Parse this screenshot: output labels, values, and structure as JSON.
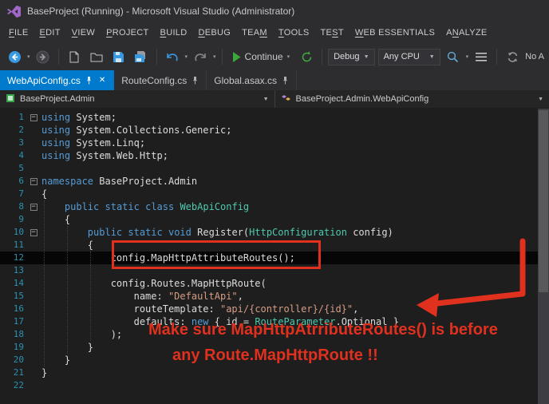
{
  "window": {
    "title": "BaseProject (Running) - Microsoft Visual Studio (Administrator)"
  },
  "menu": {
    "items": [
      {
        "label": "FILE",
        "underline": 0
      },
      {
        "label": "EDIT",
        "underline": 0
      },
      {
        "label": "VIEW",
        "underline": 0
      },
      {
        "label": "PROJECT",
        "underline": 0
      },
      {
        "label": "BUILD",
        "underline": 0
      },
      {
        "label": "DEBUG",
        "underline": 0
      },
      {
        "label": "TEAM",
        "underline": 3
      },
      {
        "label": "TOOLS",
        "underline": 0
      },
      {
        "label": "TEST",
        "underline": 2
      },
      {
        "label": "WEB ESSENTIALS",
        "underline": 0
      },
      {
        "label": "ANALYZE",
        "underline": 1
      }
    ]
  },
  "toolbar": {
    "continue_label": "Continue",
    "debug_value": "Debug",
    "platform_value": "Any CPU",
    "right_label": "No A"
  },
  "tabs": [
    {
      "label": "WebApiConfig.cs",
      "active": true,
      "pinned": true,
      "closable": true
    },
    {
      "label": "RouteConfig.cs",
      "active": false,
      "pinned": true,
      "closable": false
    },
    {
      "label": "Global.asax.cs",
      "active": false,
      "pinned": true,
      "closable": false
    }
  ],
  "breadcrumb": {
    "left": "BaseProject.Admin",
    "right": "BaseProject.Admin.WebApiConfig"
  },
  "icons": {
    "close": "✕",
    "caret_down": "▾",
    "combo_caret": "▼",
    "fold_minus": "−"
  },
  "colors": {
    "accent": "#007ACC",
    "annotation_red": "#E0301E",
    "keyword": "#569CD6",
    "type": "#4EC9B0",
    "string": "#D69D85",
    "line_number": "#2B91AF",
    "editor_bg": "#1E1E1E",
    "chrome_bg": "#2D2D30"
  },
  "code": {
    "lines": [
      {
        "n": 1,
        "fold": true,
        "tokens": [
          [
            "k",
            "using"
          ],
          [
            "p",
            " System;"
          ]
        ]
      },
      {
        "n": 2,
        "tokens": [
          [
            "k",
            "using"
          ],
          [
            "p",
            " System.Collections.Generic;"
          ]
        ]
      },
      {
        "n": 3,
        "tokens": [
          [
            "k",
            "using"
          ],
          [
            "p",
            " System.Linq;"
          ]
        ]
      },
      {
        "n": 4,
        "tokens": [
          [
            "k",
            "using"
          ],
          [
            "p",
            " System.Web.Http;"
          ]
        ]
      },
      {
        "n": 5,
        "tokens": []
      },
      {
        "n": 6,
        "fold": true,
        "tokens": [
          [
            "k",
            "namespace"
          ],
          [
            "p",
            " BaseProject.Admin"
          ]
        ]
      },
      {
        "n": 7,
        "tokens": [
          [
            "p",
            "{"
          ]
        ]
      },
      {
        "n": 8,
        "fold": true,
        "tokens": [
          [
            "p",
            "    "
          ],
          [
            "k",
            "public"
          ],
          [
            "p",
            " "
          ],
          [
            "k",
            "static"
          ],
          [
            "p",
            " "
          ],
          [
            "k",
            "class"
          ],
          [
            "p",
            " "
          ],
          [
            "t",
            "WebApiConfig"
          ]
        ]
      },
      {
        "n": 9,
        "tokens": [
          [
            "p",
            "    {"
          ]
        ]
      },
      {
        "n": 10,
        "fold": true,
        "tokens": [
          [
            "p",
            "        "
          ],
          [
            "k",
            "public"
          ],
          [
            "p",
            " "
          ],
          [
            "k",
            "static"
          ],
          [
            "p",
            " "
          ],
          [
            "k",
            "void"
          ],
          [
            "p",
            " Register("
          ],
          [
            "t",
            "HttpConfiguration"
          ],
          [
            "p",
            " config)"
          ]
        ]
      },
      {
        "n": 11,
        "tokens": [
          [
            "p",
            "        {"
          ]
        ]
      },
      {
        "n": 12,
        "hl": true,
        "tokens": [
          [
            "p",
            "            config.MapHttpAttributeRoutes();"
          ]
        ]
      },
      {
        "n": 13,
        "tokens": []
      },
      {
        "n": 14,
        "tokens": [
          [
            "p",
            "            config.Routes.MapHttpRoute("
          ]
        ]
      },
      {
        "n": 15,
        "tokens": [
          [
            "p",
            "                name: "
          ],
          [
            "s",
            "\"DefaultApi\""
          ],
          [
            "p",
            ","
          ]
        ]
      },
      {
        "n": 16,
        "tokens": [
          [
            "p",
            "                routeTemplate: "
          ],
          [
            "s",
            "\"api/{controller}/{id}\""
          ],
          [
            "p",
            ","
          ]
        ]
      },
      {
        "n": 17,
        "tokens": [
          [
            "p",
            "                defaults: "
          ],
          [
            "k",
            "new"
          ],
          [
            "p",
            " { id = "
          ],
          [
            "t",
            "RouteParameter"
          ],
          [
            "p",
            ".Optional }"
          ]
        ]
      },
      {
        "n": 18,
        "tokens": [
          [
            "p",
            "            );"
          ]
        ]
      },
      {
        "n": 19,
        "tokens": [
          [
            "p",
            "        }"
          ]
        ]
      },
      {
        "n": 20,
        "tokens": [
          [
            "p",
            "    }"
          ]
        ]
      },
      {
        "n": 21,
        "tokens": [
          [
            "p",
            "}"
          ]
        ]
      },
      {
        "n": 22,
        "tokens": []
      }
    ]
  },
  "annotations": {
    "note_line1": "Make sure MapHttpAtrributeRoutes() is before",
    "note_line2": "any Route.MapHttpRoute !!"
  }
}
